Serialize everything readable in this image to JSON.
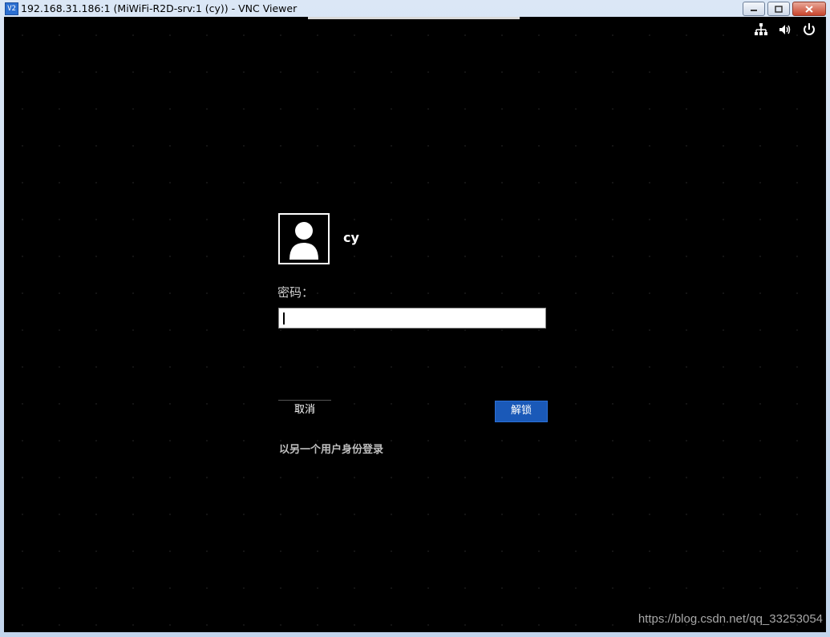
{
  "window": {
    "title": "192.168.31.186:1 (MiWiFi-R2D-srv:1 (cy)) - VNC Viewer",
    "app_icon": "vnc-icon",
    "controls": [
      "minimize",
      "maximize",
      "close"
    ]
  },
  "tray": {
    "icons": [
      "network-icon",
      "volume-icon",
      "power-icon"
    ]
  },
  "login": {
    "username": "cy",
    "password_label": "密码：",
    "password_value": "",
    "cancel_label": "取消",
    "unlock_label": "解锁",
    "switch_user_label": "以另一个用户身份登录"
  },
  "watermark": "https://blog.csdn.net/qq_33253054",
  "colors": {
    "background": "#000000",
    "unlock_button": "#1a59b8",
    "text": "#ffffff"
  }
}
